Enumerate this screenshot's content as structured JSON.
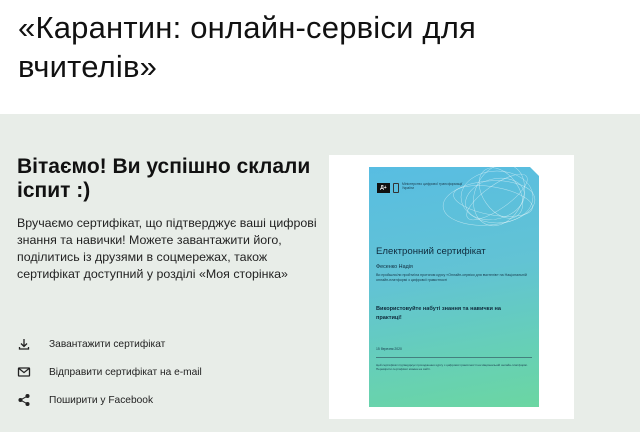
{
  "page_title": "«Карантин: онлайн-сервіси для вчителів»",
  "result": {
    "heading": "Вітаємо! Ви успішно склали іспит :)",
    "description": "Вручаємо сертифікат, що підтверджує ваші цифрові знання та навички! Можете завантажити його, поділитись із друзями в соцмережах, також сертифікат доступний у розділі «Моя сторінка»"
  },
  "actions": [
    {
      "label": "Завантажити сертифікат",
      "icon": "download-icon"
    },
    {
      "label": "Відправити сертифікат на e-mail",
      "icon": "mail-icon"
    },
    {
      "label": "Поширити у Facebook",
      "icon": "share-icon"
    }
  ],
  "certificate": {
    "logo_text": "Д+",
    "ministry": "Міністерство цифрової трансформації України",
    "title": "Електронний сертифікат",
    "name": "Фесенко Надія",
    "body": "Ви пройшли/ли пройти/ла протягом курсу «Онлайн-сервіси для вчителів» на Національній онлайн-платформі з цифрової грамотності",
    "slogan": "Використовуйте набуті знання та навички на практиці!",
    "date": "15 березня 2020",
    "footer": "Цей сертифікат підтверджує проходження курсу з цифрової грамотності на Національній онлайн-платформі. Перевірити сертифікат можна на сайті."
  },
  "colors": {
    "panel_bg": "#e8ede8",
    "cert_gradient_top": "#58bde2",
    "cert_gradient_bottom": "#6bd6a2"
  }
}
